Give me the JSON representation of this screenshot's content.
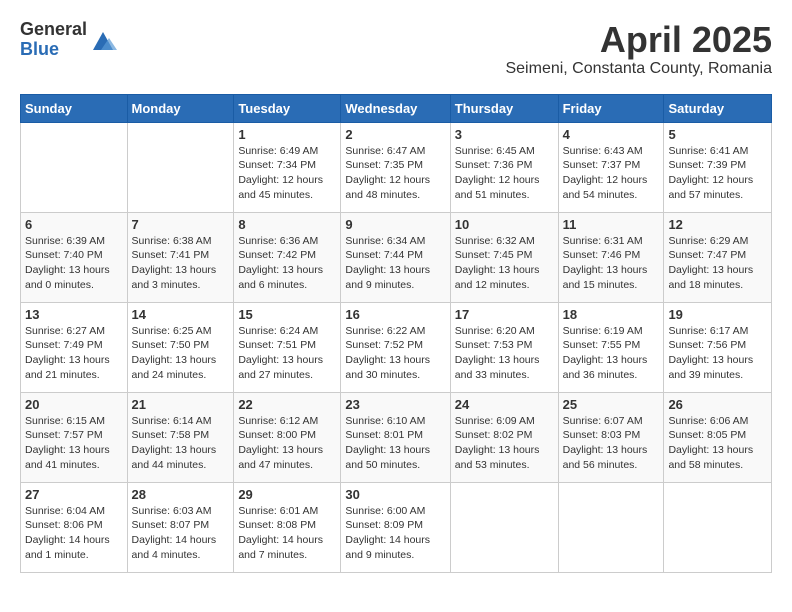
{
  "logo": {
    "general": "General",
    "blue": "Blue"
  },
  "title": "April 2025",
  "location": "Seimeni, Constanta County, Romania",
  "days_of_week": [
    "Sunday",
    "Monday",
    "Tuesday",
    "Wednesday",
    "Thursday",
    "Friday",
    "Saturday"
  ],
  "weeks": [
    [
      {
        "day": "",
        "info": ""
      },
      {
        "day": "",
        "info": ""
      },
      {
        "day": "1",
        "info": "Sunrise: 6:49 AM\nSunset: 7:34 PM\nDaylight: 12 hours and 45 minutes."
      },
      {
        "day": "2",
        "info": "Sunrise: 6:47 AM\nSunset: 7:35 PM\nDaylight: 12 hours and 48 minutes."
      },
      {
        "day": "3",
        "info": "Sunrise: 6:45 AM\nSunset: 7:36 PM\nDaylight: 12 hours and 51 minutes."
      },
      {
        "day": "4",
        "info": "Sunrise: 6:43 AM\nSunset: 7:37 PM\nDaylight: 12 hours and 54 minutes."
      },
      {
        "day": "5",
        "info": "Sunrise: 6:41 AM\nSunset: 7:39 PM\nDaylight: 12 hours and 57 minutes."
      }
    ],
    [
      {
        "day": "6",
        "info": "Sunrise: 6:39 AM\nSunset: 7:40 PM\nDaylight: 13 hours and 0 minutes."
      },
      {
        "day": "7",
        "info": "Sunrise: 6:38 AM\nSunset: 7:41 PM\nDaylight: 13 hours and 3 minutes."
      },
      {
        "day": "8",
        "info": "Sunrise: 6:36 AM\nSunset: 7:42 PM\nDaylight: 13 hours and 6 minutes."
      },
      {
        "day": "9",
        "info": "Sunrise: 6:34 AM\nSunset: 7:44 PM\nDaylight: 13 hours and 9 minutes."
      },
      {
        "day": "10",
        "info": "Sunrise: 6:32 AM\nSunset: 7:45 PM\nDaylight: 13 hours and 12 minutes."
      },
      {
        "day": "11",
        "info": "Sunrise: 6:31 AM\nSunset: 7:46 PM\nDaylight: 13 hours and 15 minutes."
      },
      {
        "day": "12",
        "info": "Sunrise: 6:29 AM\nSunset: 7:47 PM\nDaylight: 13 hours and 18 minutes."
      }
    ],
    [
      {
        "day": "13",
        "info": "Sunrise: 6:27 AM\nSunset: 7:49 PM\nDaylight: 13 hours and 21 minutes."
      },
      {
        "day": "14",
        "info": "Sunrise: 6:25 AM\nSunset: 7:50 PM\nDaylight: 13 hours and 24 minutes."
      },
      {
        "day": "15",
        "info": "Sunrise: 6:24 AM\nSunset: 7:51 PM\nDaylight: 13 hours and 27 minutes."
      },
      {
        "day": "16",
        "info": "Sunrise: 6:22 AM\nSunset: 7:52 PM\nDaylight: 13 hours and 30 minutes."
      },
      {
        "day": "17",
        "info": "Sunrise: 6:20 AM\nSunset: 7:53 PM\nDaylight: 13 hours and 33 minutes."
      },
      {
        "day": "18",
        "info": "Sunrise: 6:19 AM\nSunset: 7:55 PM\nDaylight: 13 hours and 36 minutes."
      },
      {
        "day": "19",
        "info": "Sunrise: 6:17 AM\nSunset: 7:56 PM\nDaylight: 13 hours and 39 minutes."
      }
    ],
    [
      {
        "day": "20",
        "info": "Sunrise: 6:15 AM\nSunset: 7:57 PM\nDaylight: 13 hours and 41 minutes."
      },
      {
        "day": "21",
        "info": "Sunrise: 6:14 AM\nSunset: 7:58 PM\nDaylight: 13 hours and 44 minutes."
      },
      {
        "day": "22",
        "info": "Sunrise: 6:12 AM\nSunset: 8:00 PM\nDaylight: 13 hours and 47 minutes."
      },
      {
        "day": "23",
        "info": "Sunrise: 6:10 AM\nSunset: 8:01 PM\nDaylight: 13 hours and 50 minutes."
      },
      {
        "day": "24",
        "info": "Sunrise: 6:09 AM\nSunset: 8:02 PM\nDaylight: 13 hours and 53 minutes."
      },
      {
        "day": "25",
        "info": "Sunrise: 6:07 AM\nSunset: 8:03 PM\nDaylight: 13 hours and 56 minutes."
      },
      {
        "day": "26",
        "info": "Sunrise: 6:06 AM\nSunset: 8:05 PM\nDaylight: 13 hours and 58 minutes."
      }
    ],
    [
      {
        "day": "27",
        "info": "Sunrise: 6:04 AM\nSunset: 8:06 PM\nDaylight: 14 hours and 1 minute."
      },
      {
        "day": "28",
        "info": "Sunrise: 6:03 AM\nSunset: 8:07 PM\nDaylight: 14 hours and 4 minutes."
      },
      {
        "day": "29",
        "info": "Sunrise: 6:01 AM\nSunset: 8:08 PM\nDaylight: 14 hours and 7 minutes."
      },
      {
        "day": "30",
        "info": "Sunrise: 6:00 AM\nSunset: 8:09 PM\nDaylight: 14 hours and 9 minutes."
      },
      {
        "day": "",
        "info": ""
      },
      {
        "day": "",
        "info": ""
      },
      {
        "day": "",
        "info": ""
      }
    ]
  ]
}
